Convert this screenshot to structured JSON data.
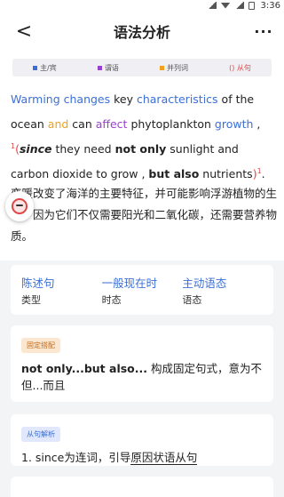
{
  "status_bar": {
    "time": "3:36"
  },
  "header": {
    "title": "语法分析",
    "back": "<",
    "more": "···"
  },
  "legend": [
    {
      "label": "主/宾",
      "color": "#3b6fd6"
    },
    {
      "label": "谓语",
      "color": "#9a3fd1"
    },
    {
      "label": "并列词",
      "color": "#f0a21c"
    },
    {
      "label": "() 从句",
      "color": "#e04545"
    }
  ],
  "sentence": {
    "w1": "Warming changes",
    "w2": " key ",
    "w3": "characteristics",
    "w4": " of the ocean ",
    "w5": "and",
    "w6": " can ",
    "w7": "affect",
    "w8": " phytoplankton ",
    "w9": "growth",
    "w10": " ,",
    "sup1": "1",
    "w11": "(",
    "w12": "since",
    "w13": " they need ",
    "w14": "not only",
    "w15": " sunlight and carbon dioxide to grow , ",
    "w16": "but also",
    "w17": " nutrients",
    "w18": ")",
    "sup2": "1",
    "w19": "."
  },
  "translation": "变暖改变了海洋的主要特征，并可能影响浮游植物的生长，因为它们不仅需要阳光和二氧化碳，还需要营养物质。",
  "properties": [
    {
      "value": "陈述句",
      "label": "类型"
    },
    {
      "value": "一般现在时",
      "label": "时态"
    },
    {
      "value": "主动语态",
      "label": "语态"
    }
  ],
  "fixed_collocation": {
    "tag": "固定搭配",
    "phrase": "not only...but also...",
    "explanation": " 构成固定句式，意为不但...而且"
  },
  "clause_analysis": {
    "tag": "从句解析",
    "prefix": "1. since为连词，引导",
    "highlight": "原因状语从句"
  }
}
